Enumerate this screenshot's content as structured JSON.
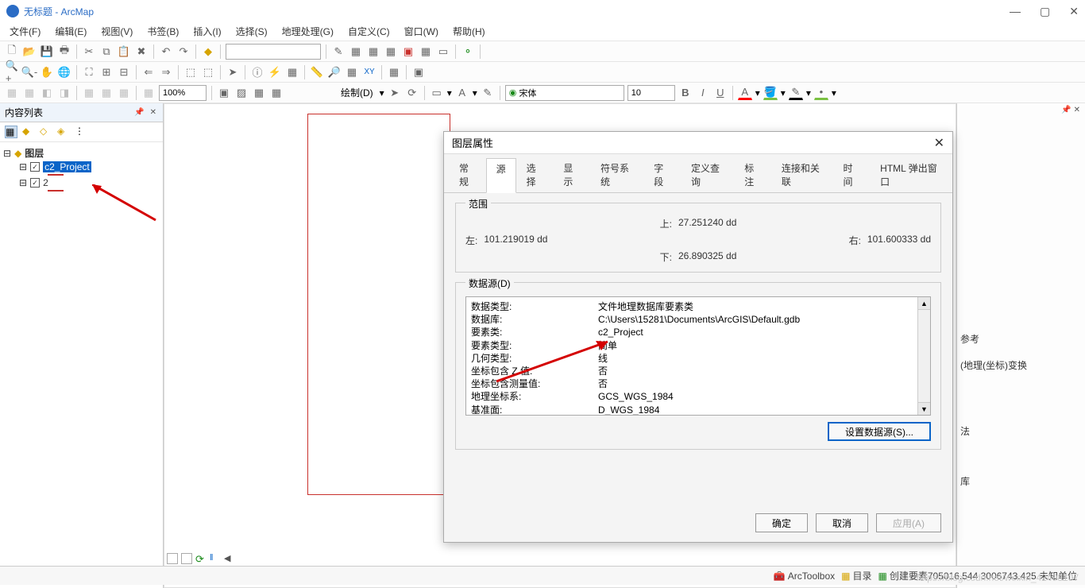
{
  "window": {
    "title": "无标题 - ArcMap"
  },
  "menu": [
    "文件(F)",
    "编辑(E)",
    "视图(V)",
    "书签(B)",
    "插入(I)",
    "选择(S)",
    "地理处理(G)",
    "自定义(C)",
    "窗口(W)",
    "帮助(H)"
  ],
  "toolbar3": {
    "percent": "100%",
    "draw_label": "绘制(D)",
    "font": "宋体",
    "fontsize": "10",
    "bold": "B",
    "italic": "I",
    "underline": "U",
    "A": "A"
  },
  "toc": {
    "title": "内容列表",
    "root": "图层",
    "layer1": "c2_Project",
    "layer2": "2"
  },
  "right_items": [
    "参考",
    "(地理(坐标)变换",
    "法",
    "库"
  ],
  "dialog": {
    "title": "图层属性",
    "tabs": [
      "常规",
      "源",
      "选择",
      "显示",
      "符号系统",
      "字段",
      "定义查询",
      "标注",
      "连接和关联",
      "时间",
      "HTML 弹出窗口"
    ],
    "active_tab": 1,
    "extent": {
      "legend": "范围",
      "top_label": "上:",
      "top_val": "27.251240 dd",
      "left_label": "左:",
      "left_val": "101.219019 dd",
      "right_label": "右:",
      "right_val": "101.600333 dd",
      "bottom_label": "下:",
      "bottom_val": "26.890325 dd"
    },
    "source": {
      "legend": "数据源(D)",
      "rows": [
        {
          "k": "数据类型:",
          "v": "文件地理数据库要素类"
        },
        {
          "k": "数据库:",
          "v": "C:\\Users\\15281\\Documents\\ArcGIS\\Default.gdb"
        },
        {
          "k": "要素类:",
          "v": "c2_Project"
        },
        {
          "k": "要素类型:",
          "v": "简单"
        },
        {
          "k": "几何类型:",
          "v": "线"
        },
        {
          "k": "坐标包含 Z 值:",
          "v": "否"
        },
        {
          "k": "坐标包含测量值:",
          "v": "否"
        },
        {
          "k": "",
          "v": ""
        },
        {
          "k": "地理坐标系:",
          "v": "GCS_WGS_1984"
        },
        {
          "k": "基准面:",
          "v": "D_WGS_1984"
        }
      ],
      "set_src_btn": "设置数据源(S)..."
    },
    "ok": "确定",
    "cancel": "取消",
    "apply": "应用(A)"
  },
  "status": {
    "arctoolbox": "ArcToolbox",
    "catalog": "目录",
    "create_feature": "创建要素",
    "coords": "705016.544  3006743.425 未知单位"
  },
  "watermark": "https://blog.csdn.net/weixin_42498107"
}
